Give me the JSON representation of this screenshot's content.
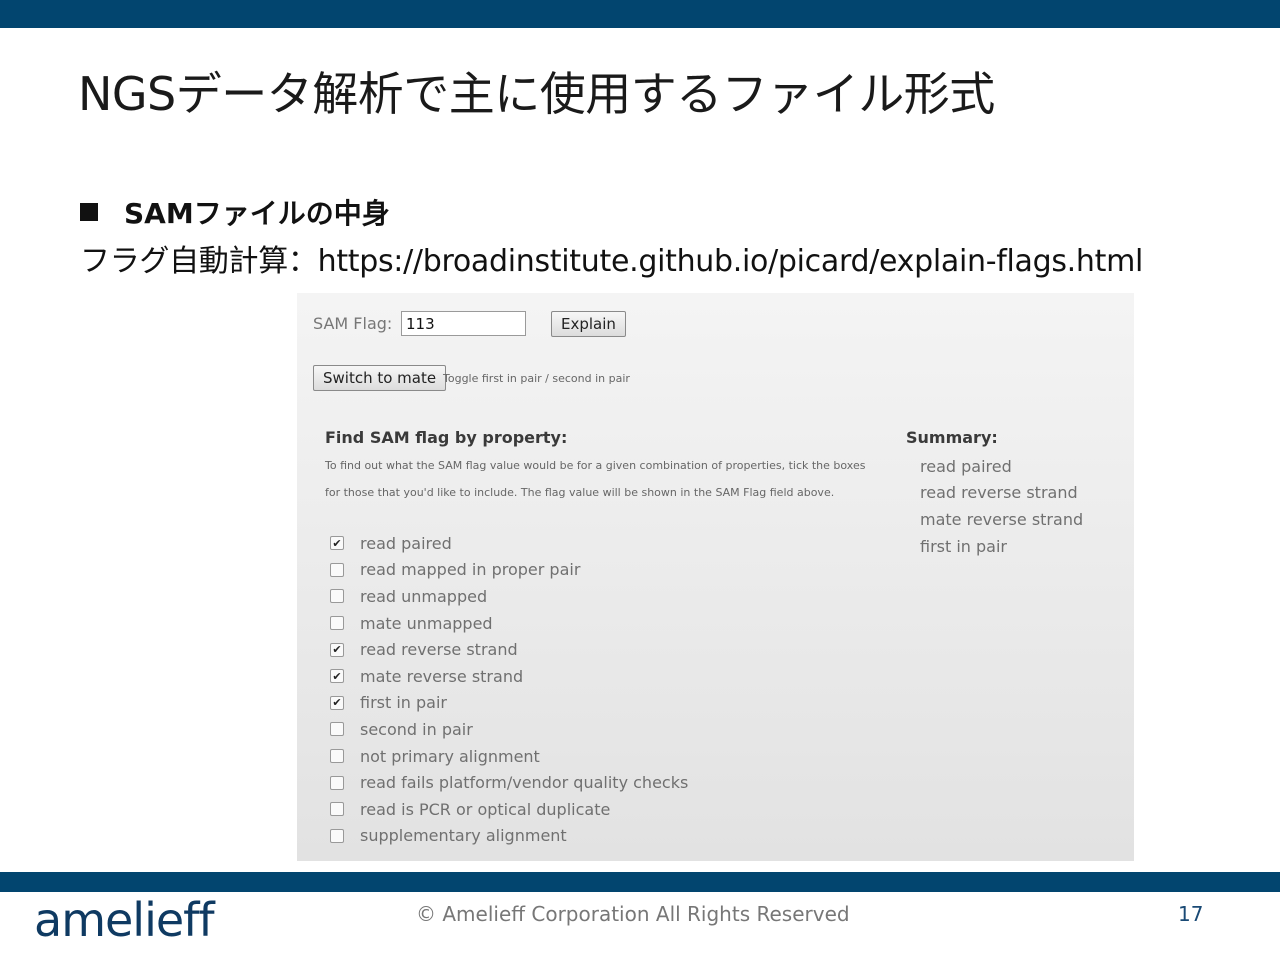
{
  "slide": {
    "title": "NGSデータ解析で主に使用するファイル形式",
    "bullet": "SAMファイルの中身",
    "flag_line": "フラグ自動計算：https://broadinstitute.github.io/picard/explain-flags.html"
  },
  "tool": {
    "flag_label": "SAM Flag:",
    "flag_value": "113",
    "explain_label": "Explain",
    "switch_label": "Switch to mate",
    "toggle_hint": "Toggle first in pair / second in pair",
    "find_heading": "Find SAM flag by property:",
    "description_line1": "To find out what the SAM flag value would be for a given combination of properties, tick the boxes",
    "description_line2": "for those that you'd like to include. The flag value will be shown in the SAM Flag field above.",
    "properties": [
      {
        "label": "read paired",
        "checked": true
      },
      {
        "label": "read mapped in proper pair",
        "checked": false
      },
      {
        "label": "read unmapped",
        "checked": false
      },
      {
        "label": "mate unmapped",
        "checked": false
      },
      {
        "label": "read reverse strand",
        "checked": true
      },
      {
        "label": "mate reverse strand",
        "checked": true
      },
      {
        "label": "first in pair",
        "checked": true
      },
      {
        "label": "second in pair",
        "checked": false
      },
      {
        "label": "not primary alignment",
        "checked": false
      },
      {
        "label": "read fails platform/vendor quality checks",
        "checked": false
      },
      {
        "label": "read is PCR or optical duplicate",
        "checked": false
      },
      {
        "label": "supplementary alignment",
        "checked": false
      }
    ],
    "summary_heading": "Summary:",
    "summary_items": [
      "read paired",
      "read reverse strand",
      "mate reverse strand",
      "first in pair"
    ]
  },
  "footer": {
    "logo": "amelieff",
    "copyright": "© Amelieff Corporation All Rights Reserved",
    "page_number": "17"
  },
  "colors": {
    "brand_bar": "#02456f",
    "logo": "#0f3a62"
  }
}
